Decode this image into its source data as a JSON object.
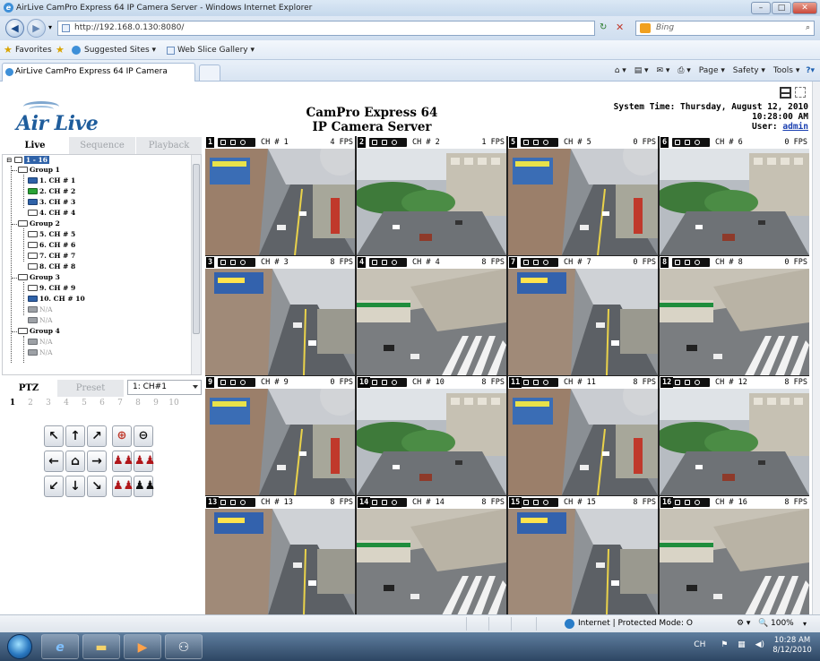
{
  "browser": {
    "window_title": "AirLive CamPro Express 64 IP Camera Server - Windows Internet Explorer",
    "url": "http://192.168.0.130:8080/",
    "search_placeholder": "Bing",
    "favorites_label": "Favorites",
    "suggested_sites": "Suggested Sites ▾",
    "web_slice_gallery": "Web Slice Gallery ▾",
    "tab_title": "AirLive CamPro Express 64 IP Camera Server",
    "commands": [
      "Page ▾",
      "Safety ▾",
      "Tools ▾"
    ],
    "status_text": "Internet | Protected Mode: O",
    "zoom": "100%"
  },
  "header": {
    "logo_text": "Air Live",
    "title_line1": "CamPro Express 64",
    "title_line2": "IP Camera Server",
    "system_time_label": "System Time: Thursday, August 12, 2010",
    "system_time_clock": "10:28:00 AM",
    "user_label": "User:",
    "user_name": "admin"
  },
  "left_tabs": [
    "Live",
    "Sequence",
    "Playback"
  ],
  "tree": {
    "root": "1 - 16",
    "groups": [
      {
        "name": "Group 1",
        "channels": [
          {
            "label": "1. CH # 1",
            "state": "blue"
          },
          {
            "label": "2. CH # 2",
            "state": "green"
          },
          {
            "label": "3. CH # 3",
            "state": "blue"
          },
          {
            "label": "4. CH # 4",
            "state": "white"
          }
        ]
      },
      {
        "name": "Group 2",
        "channels": [
          {
            "label": "5. CH # 5",
            "state": "white"
          },
          {
            "label": "6. CH # 6",
            "state": "white"
          },
          {
            "label": "7. CH # 7",
            "state": "white"
          },
          {
            "label": "8. CH # 8",
            "state": "white"
          }
        ]
      },
      {
        "name": "Group 3",
        "channels": [
          {
            "label": "9. CH # 9",
            "state": "white"
          },
          {
            "label": "10. CH # 10",
            "state": "blue"
          },
          {
            "label": "N/A",
            "state": "gray"
          },
          {
            "label": "N/A",
            "state": "gray"
          }
        ]
      },
      {
        "name": "Group 4",
        "channels": [
          {
            "label": "N/A",
            "state": "gray"
          },
          {
            "label": "N/A",
            "state": "gray"
          }
        ]
      }
    ]
  },
  "ptz": {
    "tab_ptz": "PTZ",
    "tab_preset": "Preset",
    "channel_select": "1: CH#1",
    "preset_numbers": [
      "1",
      "2",
      "3",
      "4",
      "5",
      "6",
      "7",
      "8",
      "9",
      "10"
    ],
    "active_preset": "1"
  },
  "cameras": [
    {
      "num": "1",
      "name": "CH # 1",
      "fps": "4 FPS",
      "scene": "street"
    },
    {
      "num": "2",
      "name": "CH # 2",
      "fps": "1 FPS",
      "scene": "park"
    },
    {
      "num": "5",
      "name": "CH # 5",
      "fps": "0 FPS",
      "scene": "street"
    },
    {
      "num": "6",
      "name": "CH # 6",
      "fps": "0 FPS",
      "scene": "park"
    },
    {
      "num": "3",
      "name": "CH # 3",
      "fps": "8 FPS",
      "scene": "road"
    },
    {
      "num": "4",
      "name": "CH # 4",
      "fps": "8 FPS",
      "scene": "crossing"
    },
    {
      "num": "7",
      "name": "CH # 7",
      "fps": "0 FPS",
      "scene": "road"
    },
    {
      "num": "8",
      "name": "CH # 8",
      "fps": "0 FPS",
      "scene": "crossing"
    },
    {
      "num": "9",
      "name": "CH # 9",
      "fps": "0 FPS",
      "scene": "street"
    },
    {
      "num": "10",
      "name": "CH # 10",
      "fps": "8 FPS",
      "scene": "park"
    },
    {
      "num": "11",
      "name": "CH # 11",
      "fps": "8 FPS",
      "scene": "street"
    },
    {
      "num": "12",
      "name": "CH # 12",
      "fps": "8 FPS",
      "scene": "park"
    },
    {
      "num": "13",
      "name": "CH # 13",
      "fps": "8 FPS",
      "scene": "road"
    },
    {
      "num": "14",
      "name": "CH # 14",
      "fps": "8 FPS",
      "scene": "crossing"
    },
    {
      "num": "15",
      "name": "CH # 15",
      "fps": "8 FPS",
      "scene": "road"
    },
    {
      "num": "16",
      "name": "CH # 16",
      "fps": "8 FPS",
      "scene": "crossing"
    }
  ],
  "taskbar": {
    "tray_text": "CH",
    "clock_time": "10:28 AM",
    "clock_date": "8/12/2010"
  },
  "colors": {
    "brand_blue": "#1f5d9c",
    "link_blue": "#1a3fb0",
    "status_active_blue": "#2f62a8",
    "status_active_green": "#2aa336"
  }
}
